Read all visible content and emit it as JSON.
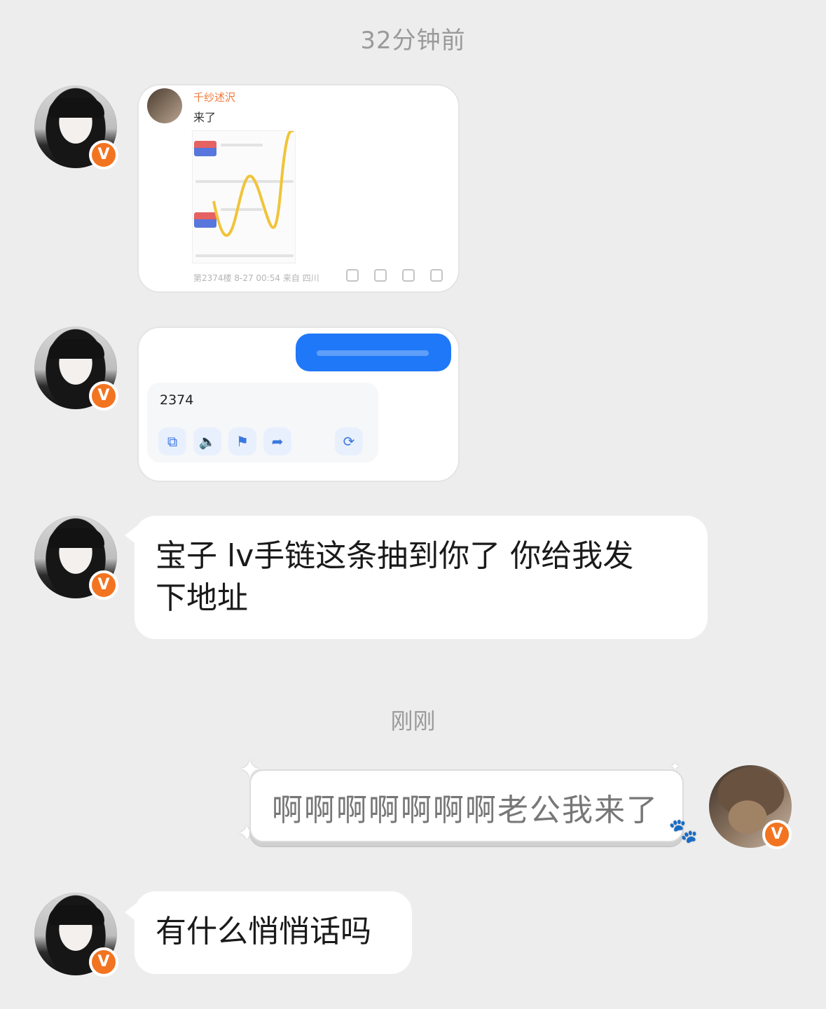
{
  "timestamps": {
    "top": "32分钟前",
    "mid": "刚刚"
  },
  "card_post": {
    "author": "千纱述沢",
    "text": "来了",
    "footer": "第2374楼 8-27 00:54 来自 四川"
  },
  "card_ai": {
    "reply_number": "2374",
    "action_icons": [
      "copy-icon",
      "speaker-icon",
      "bookmark-icon",
      "share-icon",
      "refresh-icon"
    ]
  },
  "messages": {
    "m3": "宝子 lv手链这条抽到你了 你给我发下地址",
    "m3_line1": "宝子 lv手链这条抽到你了 你给我发",
    "m3_line2": "下地址",
    "m4": "啊啊啊啊啊啊啊老公我来了",
    "m5": "有什么悄悄话吗"
  },
  "badge": "V",
  "colors": {
    "background": "#ededed",
    "badge": "#f27421",
    "blue": "#1f78f7"
  }
}
